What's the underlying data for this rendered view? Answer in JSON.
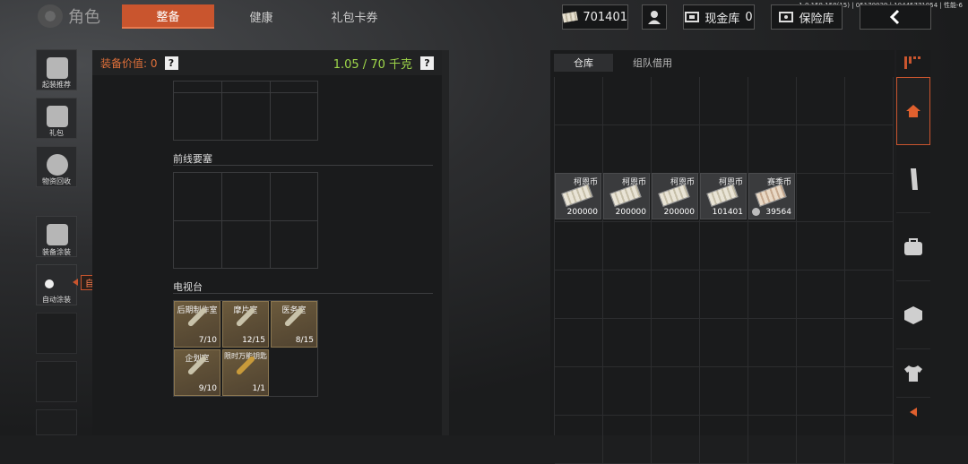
{
  "version_info": "1.0.158.158(15) | 05170039 | 10445771954 | 性能-6",
  "header": {
    "title": "角色",
    "tabs": [
      {
        "label": "整备",
        "active": true
      },
      {
        "label": "健康",
        "active": false
      },
      {
        "label": "礼包卡券",
        "active": false
      }
    ],
    "currency_amount": "701401",
    "cash_vault_label": "现金库",
    "cash_vault_count": "0",
    "safe_label": "保险库"
  },
  "sidebar": {
    "items": [
      {
        "label": "起装推荐",
        "icon": "gun-recommend-icon"
      },
      {
        "label": "礼包",
        "icon": "gift-icon"
      },
      {
        "label": "物资回收",
        "icon": "recycle-icon"
      },
      {
        "label": "装备涂装",
        "icon": "paint-helmet-icon"
      },
      {
        "label": "自动涂装",
        "icon": "toggle-icon"
      }
    ],
    "tooltip": "自动涂装"
  },
  "left_panel": {
    "equip_value_label": "装备价值: 0",
    "weight": "1.05 / 70 千克",
    "sections": [
      {
        "title": "前线要塞"
      },
      {
        "title": "电视台"
      }
    ],
    "keys": [
      {
        "name": "后期制作室",
        "count": "7/10"
      },
      {
        "name": "摩片室",
        "count": "12/15"
      },
      {
        "name": "医务室",
        "count": "8/15"
      },
      {
        "name": "企划室",
        "count": "9/10"
      },
      {
        "name": "限时万能钥匙",
        "count": "1/1"
      }
    ]
  },
  "right_panel": {
    "tabs": [
      {
        "label": "仓库",
        "active": true
      },
      {
        "label": "组队借用",
        "active": false
      }
    ],
    "items": [
      {
        "name": "柯恩币",
        "value": "200000"
      },
      {
        "name": "柯恩币",
        "value": "200000"
      },
      {
        "name": "柯恩币",
        "value": "200000"
      },
      {
        "name": "柯恩币",
        "value": "101401"
      },
      {
        "name": "赛季币",
        "value": "39564"
      }
    ]
  },
  "right_sidebar": {
    "items": [
      "filter-icon",
      "home-icon",
      "magazine-icon",
      "medkit-icon",
      "box-icon",
      "shirt-icon",
      "arrow-left-icon"
    ]
  },
  "colors": {
    "accent": "#c9552e",
    "weight_green": "#9fd84a",
    "value_orange": "#e0703a"
  }
}
